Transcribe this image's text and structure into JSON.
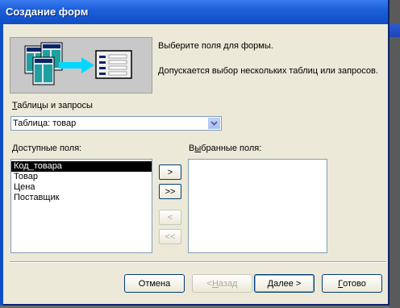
{
  "window": {
    "title": "Создание форм"
  },
  "intro": {
    "line1": "Выберите поля для формы.",
    "line2": "Допускается выбор нескольких таблиц или запросов."
  },
  "tables": {
    "label": "Таблицы и запросы",
    "label_access_key": "Т",
    "label_rest": "аблицы и запросы",
    "selected": "Таблица: товар"
  },
  "available": {
    "label_access_key": "Д",
    "label_rest": "оступные поля:",
    "items": [
      "Код_товара",
      "Товар",
      "Цена",
      "Поставщик"
    ],
    "selected_index": 0
  },
  "chosen": {
    "label_pre": "В",
    "label_access_key": "ы",
    "label_rest": "бранные поля:",
    "items": []
  },
  "move_buttons": {
    "add_one": ">",
    "add_all": ">>",
    "remove_one": "<",
    "remove_all": "<<"
  },
  "buttons": {
    "cancel": "Отмена",
    "back_pre": "< ",
    "back_key": "Н",
    "back_rest": "азад",
    "next_key": "Д",
    "next_rest": "алее >",
    "finish_key": "Г",
    "finish_rest": "отово"
  },
  "colors": {
    "titlebar": "#1c5fd9",
    "dialog": "#ece9d8",
    "selection": "#000000"
  }
}
